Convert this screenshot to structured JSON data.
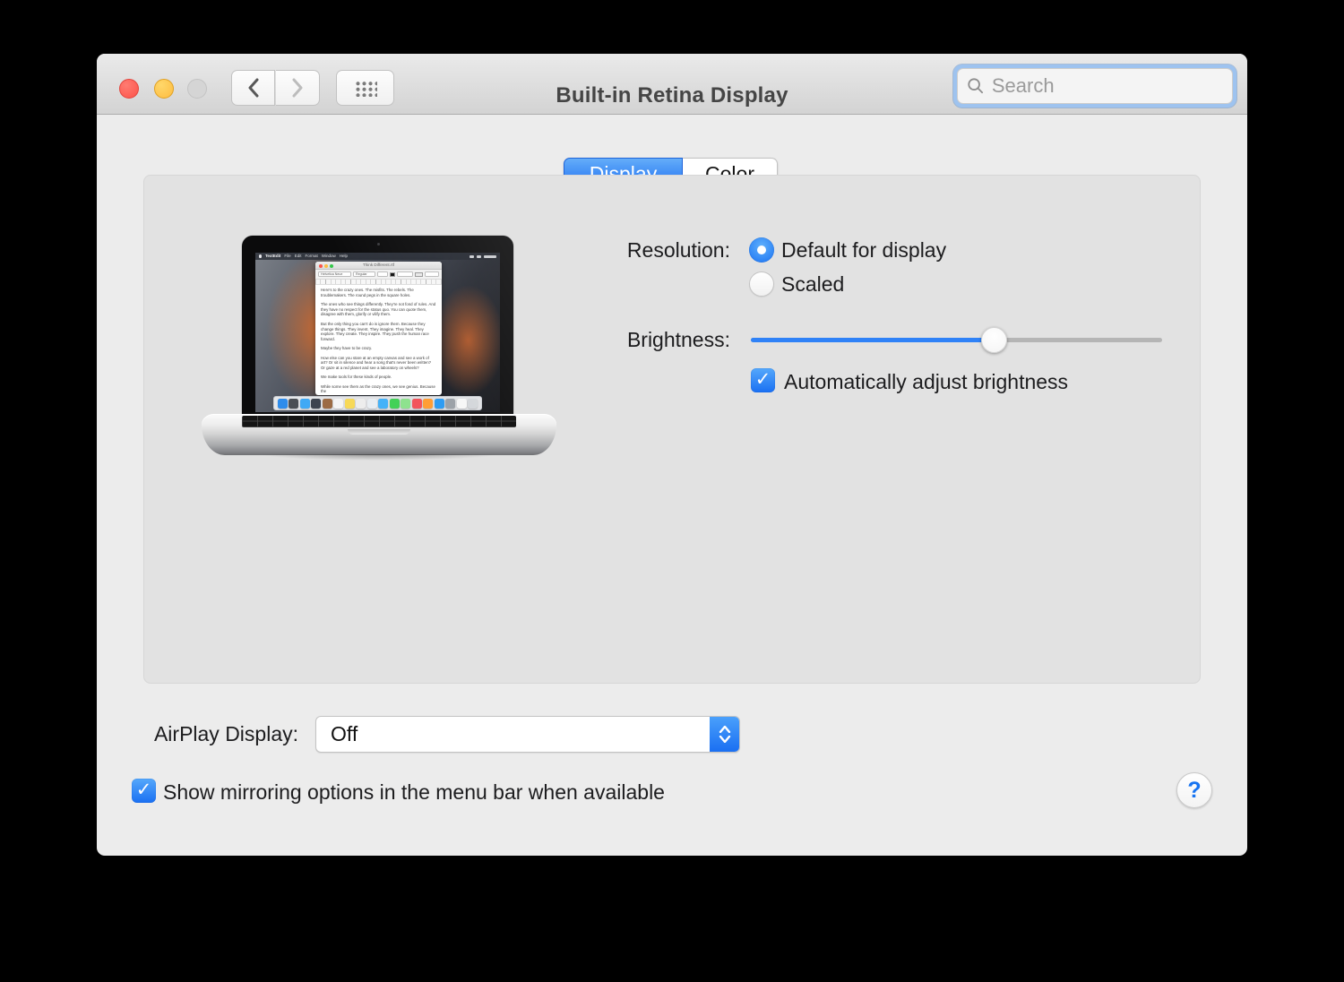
{
  "window": {
    "title": "Built-in Retina Display",
    "search": {
      "placeholder": "Search"
    }
  },
  "tabs": {
    "display": "Display",
    "color": "Color",
    "selected": "Display"
  },
  "display_pane": {
    "resolution_label": "Resolution:",
    "resolution_options": [
      {
        "label": "Default for display",
        "selected": true
      },
      {
        "label": "Scaled",
        "selected": false
      }
    ],
    "brightness_label": "Brightness:",
    "brightness_percent": 59,
    "auto_brightness": {
      "label": "Automatically adjust brightness",
      "checked": true
    }
  },
  "footer": {
    "airplay_label": "AirPlay Display:",
    "airplay_value": "Off",
    "mirroring": {
      "label": "Show mirroring options in the menu bar when available",
      "checked": true
    },
    "help_label": "?"
  },
  "laptop_preview": {
    "menu_bar": {
      "app": "TextEdit",
      "menus": [
        "File",
        "Edit",
        "Format",
        "Window",
        "Help"
      ]
    },
    "textedit": {
      "title": "Think Different.rtf",
      "font_name": "Helvetica Neue",
      "font_style": "Regular",
      "paragraphs": [
        "Here's to the crazy ones. The misfits. The rebels. The troublemakers. The round pegs in the square holes.",
        "The ones who see things differently. They're not fond of rules. And they have no respect for the status quo. You can quote them, disagree with them, glorify or vilify them.",
        "But the only thing you can't do is ignore them. Because they change things. They invent. They imagine. They heal. They explore. They create. They inspire. They push the human race forward.",
        "Maybe they have to be crazy.",
        "How else can you stare at an empty canvas and see a work of art? Or sit in silence and hear a song that's never been written? Or gaze at a red planet and see a laboratory on wheels?",
        "We make tools for these kinds of people.",
        "While some see them as the crazy ones, we see genius. Because the"
      ]
    },
    "dock_icons": [
      {
        "name": "finder",
        "color": "#2e8ceb"
      },
      {
        "name": "launchpad",
        "color": "#4a4f55"
      },
      {
        "name": "safari",
        "color": "#3fa9f5"
      },
      {
        "name": "photo-booth",
        "color": "#3d4450"
      },
      {
        "name": "contacts",
        "color": "#9c6b44"
      },
      {
        "name": "calendar",
        "color": "#f4f4f4"
      },
      {
        "name": "notes",
        "color": "#f7d958"
      },
      {
        "name": "reminders",
        "color": "#ededed"
      },
      {
        "name": "photos",
        "color": "#e8edf2"
      },
      {
        "name": "messages",
        "color": "#45b2f8"
      },
      {
        "name": "facetime",
        "color": "#43d158"
      },
      {
        "name": "maps",
        "color": "#8ee28e"
      },
      {
        "name": "itunes",
        "color": "#f2545b"
      },
      {
        "name": "ibooks",
        "color": "#ff9d33"
      },
      {
        "name": "app-store",
        "color": "#2a9af2"
      },
      {
        "name": "system-preferences",
        "color": "#9aa0a6"
      },
      {
        "name": "textedit-doc",
        "color": "#f7f7f7"
      },
      {
        "name": "trash",
        "color": "#d3d6da"
      }
    ]
  },
  "colors": {
    "accent_blue": "#1a70f2",
    "slider_blue": "#2f82f7",
    "selected_tab_top": "#64adf9"
  }
}
